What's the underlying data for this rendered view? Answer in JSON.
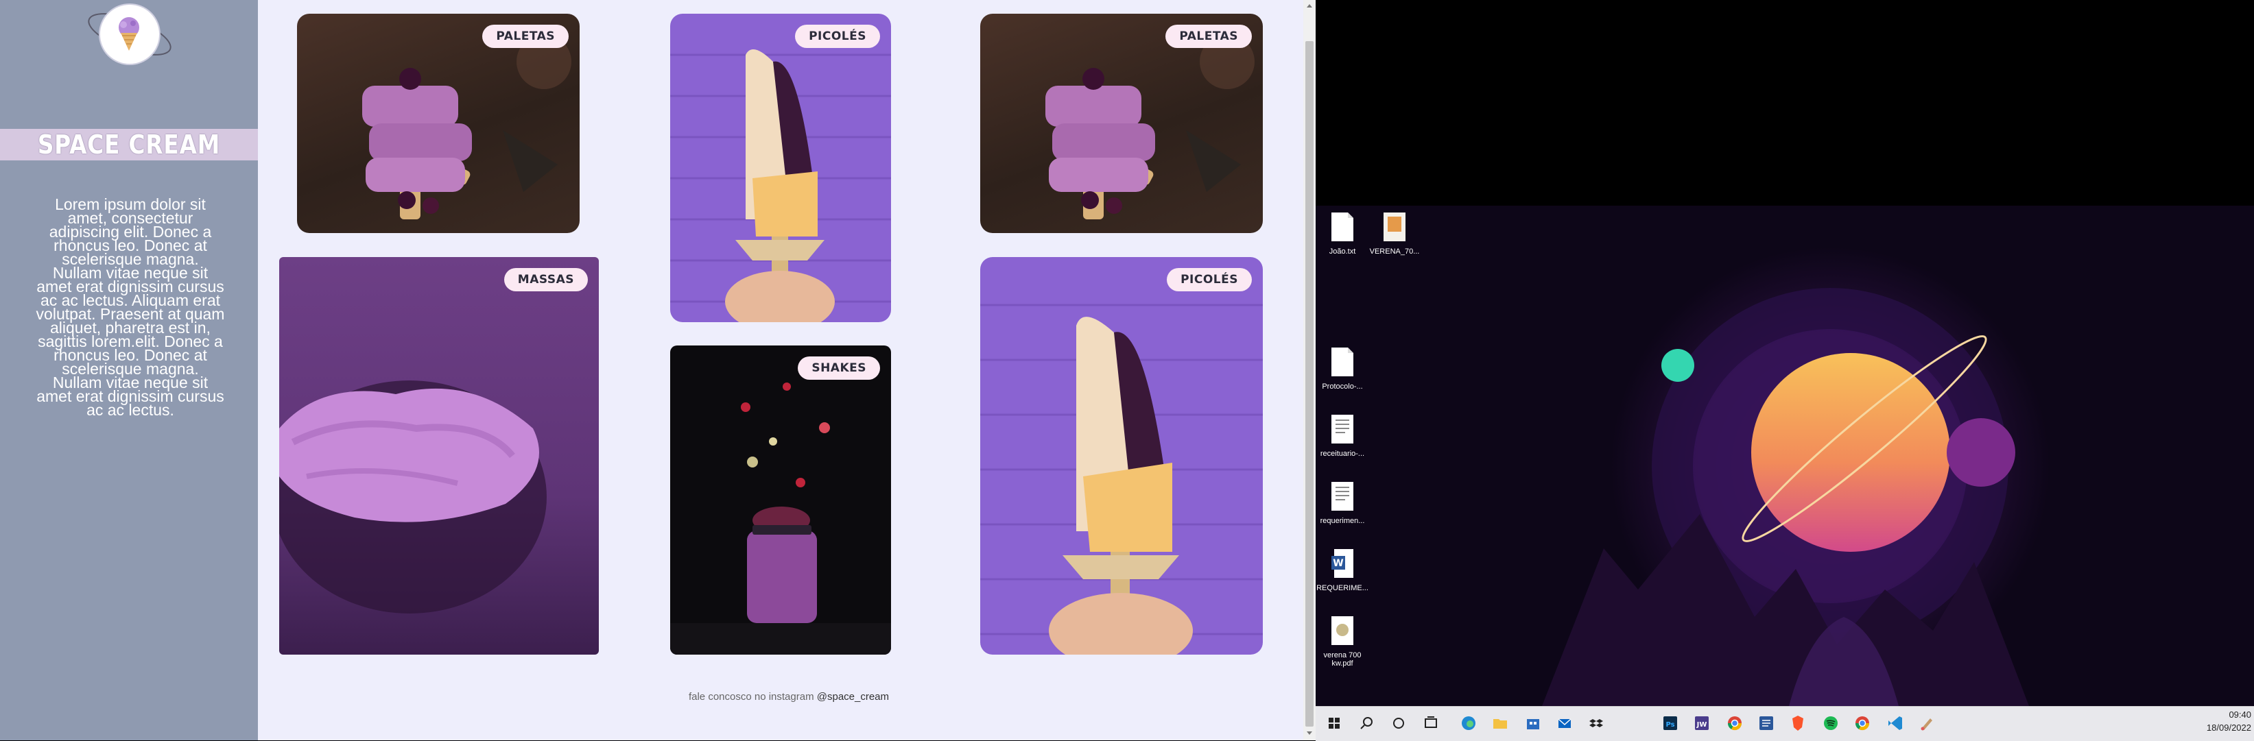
{
  "site": {
    "brand": "SPACE CREAM",
    "description": "Lorem ipsum dolor sit amet, consectetur adipiscing elit. Donec a rhoncus leo. Donec at scelerisque magna. Nullam vitae neque sit amet erat dignissim cursus ac ac lectus. Aliquam erat volutpat. Praesent at quam aliquet, pharetra est in, sagittis lorem.elit. Donec a rhoncus leo. Donec at scelerisque magna. Nullam vitae neque sit amet erat dignissim cursus ac ac lectus.",
    "cards": [
      {
        "label": "PALETAS"
      },
      {
        "label": "PICOLÉS"
      },
      {
        "label": "PALETAS"
      },
      {
        "label": "MASSAS"
      },
      {
        "label": "SHAKES"
      },
      {
        "label": "PICOLÉS"
      }
    ],
    "footer_text": "fale concosco no instagram",
    "footer_handle": "@space_cream"
  },
  "desktop": {
    "icons": [
      {
        "label": "João.txt"
      },
      {
        "label": "VERENA_70..."
      },
      {
        "label": "Protocolo-..."
      },
      {
        "label": "receituario-..."
      },
      {
        "label": "requerimen..."
      },
      {
        "label": "REQUERIME..."
      },
      {
        "label": "verena 700 kw.pdf"
      }
    ]
  },
  "taskbar": {
    "time": "09:40",
    "date": "18/09/2022",
    "apps": [
      "start-icon",
      "search-icon",
      "cortana-icon",
      "task-view-icon",
      "edge-icon",
      "explorer-icon",
      "store-icon",
      "mail-icon",
      "dropbox-icon",
      "photoshop-icon",
      "jw-icon",
      "chrome-icon",
      "word-icon",
      "brave-icon",
      "spotify-icon",
      "chrome-profile-icon",
      "vscode-icon",
      "paint-icon"
    ]
  },
  "colors": {
    "sidebar": "#8f9ab0",
    "page_bg": "#eeeefc",
    "badge_bg": "#fbe9f3",
    "purple": "#8a63d2"
  }
}
